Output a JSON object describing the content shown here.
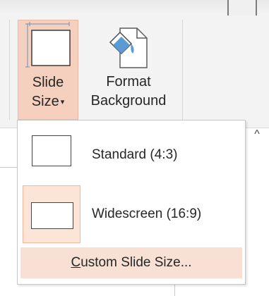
{
  "ribbon": {
    "slide_size": {
      "line1": "Slide",
      "line2": "Size",
      "caret": "▾"
    },
    "format_background": {
      "line1": "Format",
      "line2": "Background"
    },
    "collapse_glyph": "^"
  },
  "dropdown": {
    "options": [
      {
        "label": "Standard (4:3)",
        "selected": false
      },
      {
        "label": "Widescreen (16:9)",
        "selected": true
      }
    ],
    "custom": {
      "mnemonic": "C",
      "rest": "ustom Slide Size..."
    }
  },
  "colors": {
    "accent_pressed": "#f5d0bf",
    "accent_hover": "#f8e0d4",
    "selected_fill": "#fce4d6",
    "paint_bucket_blue": "#5b9bd5"
  }
}
